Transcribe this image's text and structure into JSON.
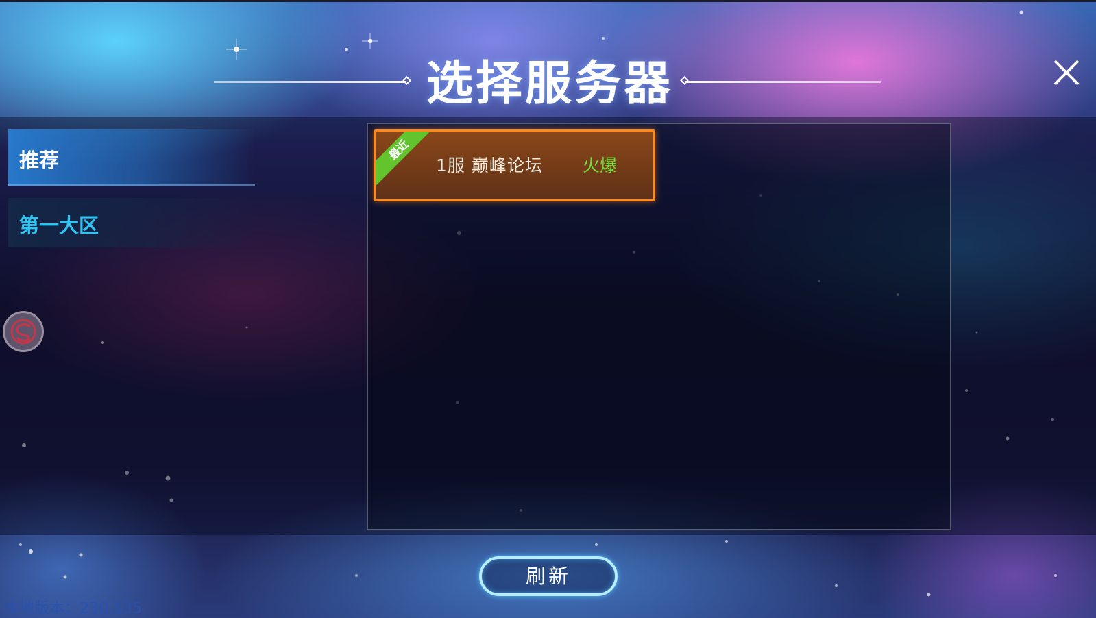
{
  "header": {
    "title": "选择服务器",
    "close_icon": "close-icon"
  },
  "sidebar": {
    "items": [
      {
        "label": "推荐",
        "active": true
      },
      {
        "label": "第一大区",
        "active": false
      }
    ],
    "side_badge_icon": "swirl-logo-icon"
  },
  "servers": [
    {
      "name": "1服  巅峰论坛",
      "status": "火爆",
      "tag": "最近"
    }
  ],
  "footer": {
    "refresh_label": "刷新",
    "version": "本地版本：230.135"
  },
  "colors": {
    "card_border": "#ff8a1a",
    "tag_green": "#62c52d",
    "status_green": "#6fdc38",
    "sidebar_inactive_text": "#2ec4f2",
    "refresh_border": "#b8ecff"
  }
}
